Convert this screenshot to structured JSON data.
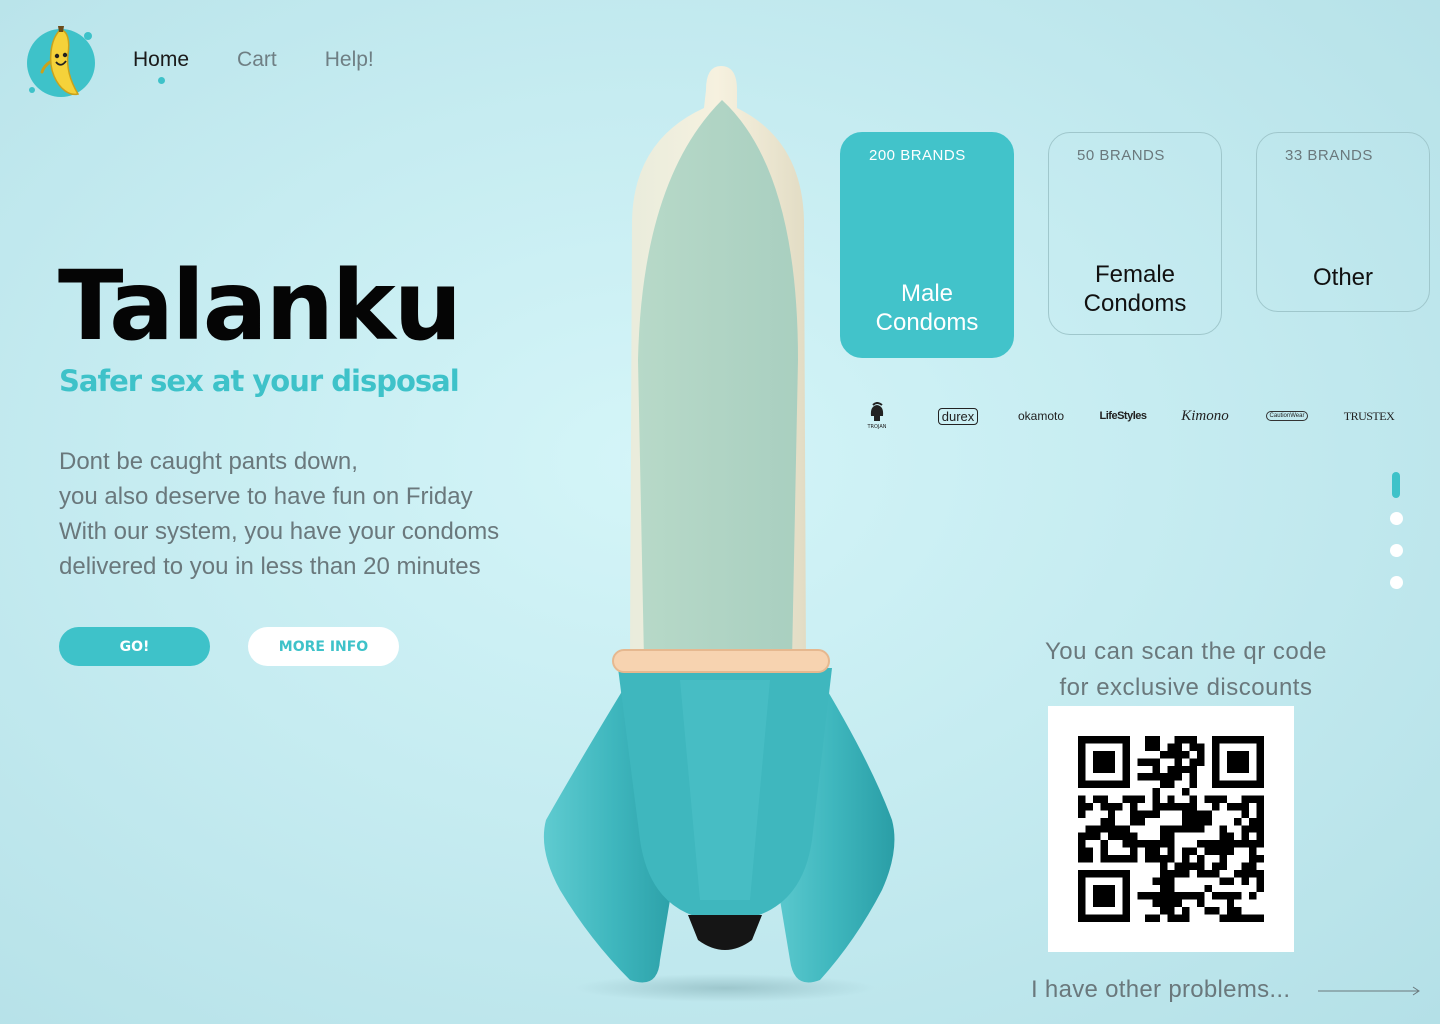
{
  "nav": {
    "items": [
      {
        "label": "Home",
        "active": true
      },
      {
        "label": "Cart",
        "active": false
      },
      {
        "label": "Help!",
        "active": false
      }
    ]
  },
  "hero": {
    "title": "Talanku",
    "tagline": "Safer sex at your disposal",
    "description": [
      "Dont be caught pants down,",
      "you also deserve to have fun on Friday",
      "With our system, you have your condoms",
      "delivered to you in less than 20 minutes"
    ],
    "primary_button": "GO!",
    "secondary_button": "MORE INFO"
  },
  "categories": [
    {
      "count": "200 BRANDS",
      "label_line1": "Male",
      "label_line2": "Condoms",
      "active": true
    },
    {
      "count": "50 BRANDS",
      "label_line1": "Female",
      "label_line2": "Condoms",
      "active": false
    },
    {
      "count": "33 BRANDS",
      "label_line1": "Other",
      "label_line2": "",
      "active": false
    }
  ],
  "brands": [
    "TROJAN",
    "durex",
    "okamoto",
    "LifeStyles",
    "Kimono",
    "CautionWear",
    "TRUSTEX"
  ],
  "pagination": {
    "total": 4,
    "current": 1
  },
  "qr": {
    "caption_line1": "You can scan the qr code",
    "caption_line2": "for exclusive discounts"
  },
  "footer_link": "I have other problems...",
  "colors": {
    "accent": "#3ec2c9",
    "card_active": "#42c3ca",
    "text_muted": "#6a787c",
    "background": "#c6ecf1"
  }
}
